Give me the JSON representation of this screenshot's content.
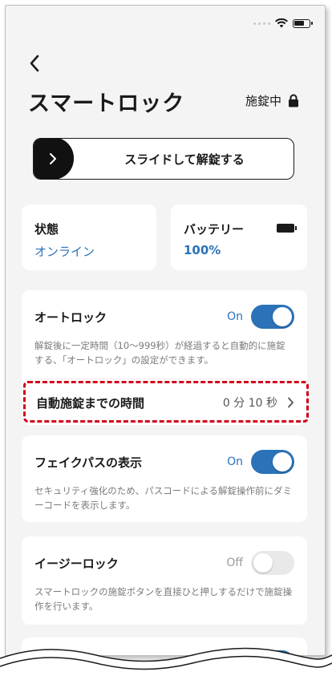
{
  "header": {
    "title": "スマートロック",
    "lock_status": "施錠中"
  },
  "slider": {
    "label": "スライドして解錠する"
  },
  "status_card": {
    "label": "状態",
    "value": "オンライン"
  },
  "battery_card": {
    "label": "バッテリー",
    "value": "100%"
  },
  "auto_lock": {
    "title": "オートロック",
    "state": "On",
    "enabled": true,
    "description": "解錠後に一定時間（10〜999秒）が経過すると自動的に施錠する、「オートロック」の設定ができます。",
    "time_label": "自動施錠までの時間",
    "time_value": "0 分 10 秒"
  },
  "fake_pass": {
    "title": "フェイクパスの表示",
    "state": "On",
    "enabled": true,
    "description": "セキュリティ強化のため、パスコードによる解錠操作前にダミーコードを表示します。"
  },
  "easy_lock": {
    "title": "イージーロック",
    "state": "Off",
    "enabled": false,
    "description": "スマートロックの施錠ボタンを直接ひと押しするだけで施錠操作を行います。"
  },
  "colors": {
    "accent": "#2b72b8",
    "highlight": "#d0021b",
    "background": "#f4f4f4"
  }
}
